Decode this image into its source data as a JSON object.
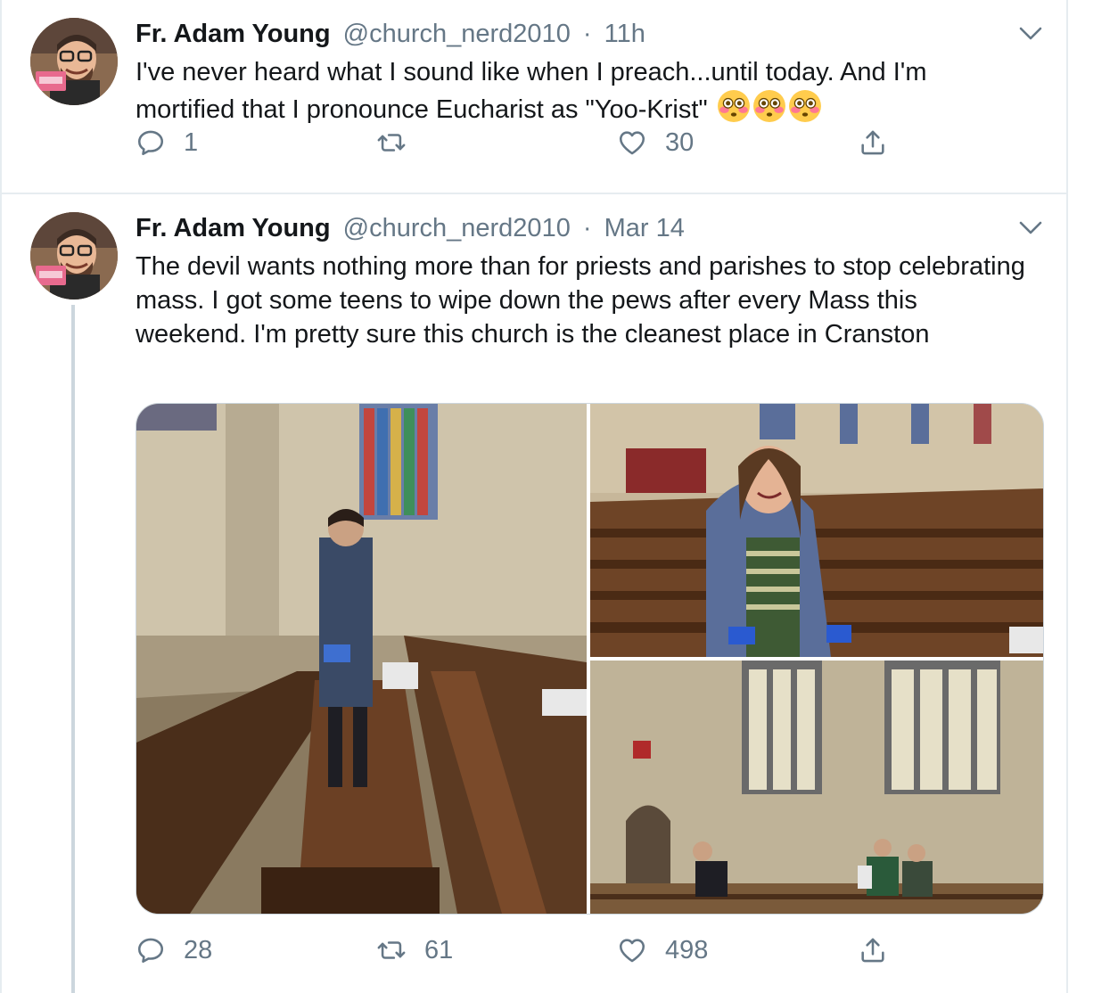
{
  "tweets": [
    {
      "author_name": "Fr. Adam Young",
      "handle": "@church_nerd2010",
      "separator": "·",
      "time": "11h",
      "text": "I've never heard what I sound like when I preach...until today. And I'm mortified that I pronounce Eucharist as \"Yoo-Krist\"",
      "emoji_icons": [
        "flushed-face-icon",
        "flushed-face-icon",
        "flushed-face-icon"
      ],
      "replies": "1",
      "retweets": "",
      "likes": "30"
    },
    {
      "author_name": "Fr. Adam Young",
      "handle": "@church_nerd2010",
      "separator": "·",
      "time": "Mar 14",
      "text": "The devil wants nothing more than for priests and parishes to stop celebrating mass. I got some teens to wipe down the pews after every Mass this weekend. I'm pretty sure this church is the cleanest place in Cranston",
      "replies": "28",
      "retweets": "61",
      "likes": "498"
    }
  ],
  "colors": {
    "text_primary": "#14171a",
    "text_secondary": "#657786",
    "divider": "#e6ecf0",
    "thread_line": "#ccd6dd"
  },
  "icons": {
    "reply": "reply-icon",
    "retweet": "retweet-icon",
    "like": "heart-icon",
    "share": "share-icon",
    "menu": "chevron-down-icon"
  }
}
